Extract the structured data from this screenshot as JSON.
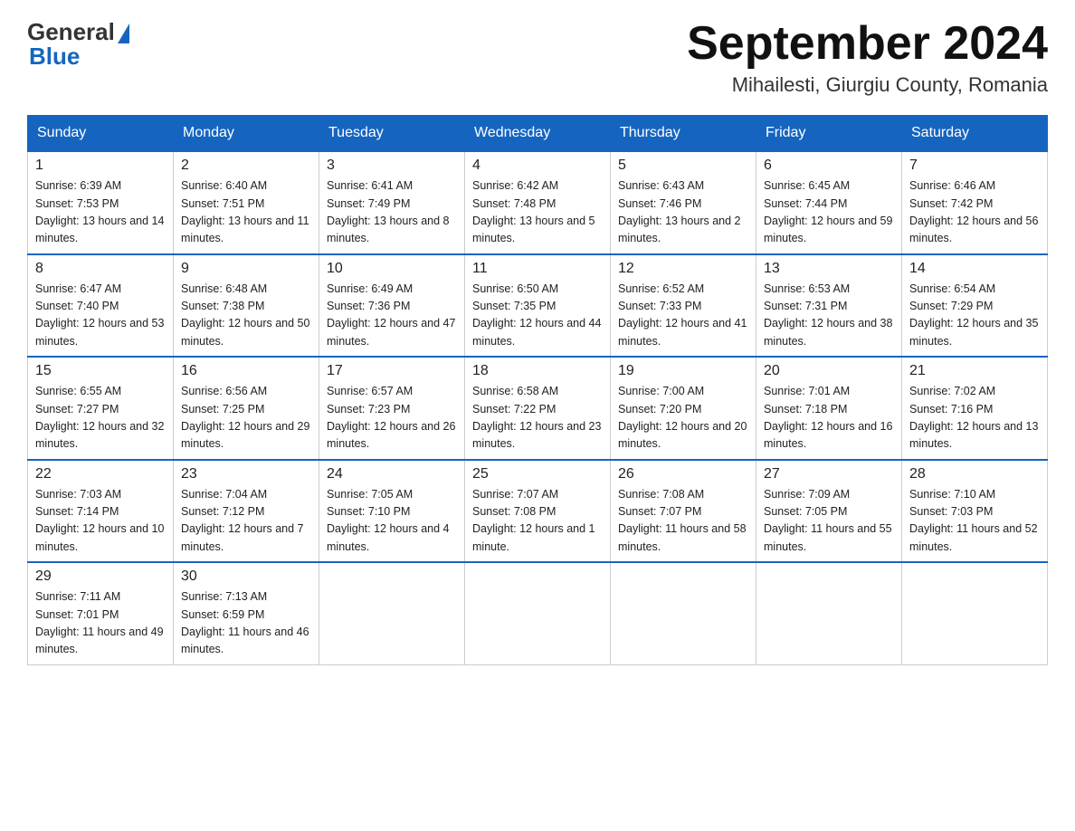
{
  "header": {
    "logo_general": "General",
    "logo_blue": "Blue",
    "month_title": "September 2024",
    "location": "Mihailesti, Giurgiu County, Romania"
  },
  "days_of_week": [
    "Sunday",
    "Monday",
    "Tuesday",
    "Wednesday",
    "Thursday",
    "Friday",
    "Saturday"
  ],
  "weeks": [
    [
      {
        "day": "1",
        "sunrise": "6:39 AM",
        "sunset": "7:53 PM",
        "daylight": "13 hours and 14 minutes."
      },
      {
        "day": "2",
        "sunrise": "6:40 AM",
        "sunset": "7:51 PM",
        "daylight": "13 hours and 11 minutes."
      },
      {
        "day": "3",
        "sunrise": "6:41 AM",
        "sunset": "7:49 PM",
        "daylight": "13 hours and 8 minutes."
      },
      {
        "day": "4",
        "sunrise": "6:42 AM",
        "sunset": "7:48 PM",
        "daylight": "13 hours and 5 minutes."
      },
      {
        "day": "5",
        "sunrise": "6:43 AM",
        "sunset": "7:46 PM",
        "daylight": "13 hours and 2 minutes."
      },
      {
        "day": "6",
        "sunrise": "6:45 AM",
        "sunset": "7:44 PM",
        "daylight": "12 hours and 59 minutes."
      },
      {
        "day": "7",
        "sunrise": "6:46 AM",
        "sunset": "7:42 PM",
        "daylight": "12 hours and 56 minutes."
      }
    ],
    [
      {
        "day": "8",
        "sunrise": "6:47 AM",
        "sunset": "7:40 PM",
        "daylight": "12 hours and 53 minutes."
      },
      {
        "day": "9",
        "sunrise": "6:48 AM",
        "sunset": "7:38 PM",
        "daylight": "12 hours and 50 minutes."
      },
      {
        "day": "10",
        "sunrise": "6:49 AM",
        "sunset": "7:36 PM",
        "daylight": "12 hours and 47 minutes."
      },
      {
        "day": "11",
        "sunrise": "6:50 AM",
        "sunset": "7:35 PM",
        "daylight": "12 hours and 44 minutes."
      },
      {
        "day": "12",
        "sunrise": "6:52 AM",
        "sunset": "7:33 PM",
        "daylight": "12 hours and 41 minutes."
      },
      {
        "day": "13",
        "sunrise": "6:53 AM",
        "sunset": "7:31 PM",
        "daylight": "12 hours and 38 minutes."
      },
      {
        "day": "14",
        "sunrise": "6:54 AM",
        "sunset": "7:29 PM",
        "daylight": "12 hours and 35 minutes."
      }
    ],
    [
      {
        "day": "15",
        "sunrise": "6:55 AM",
        "sunset": "7:27 PM",
        "daylight": "12 hours and 32 minutes."
      },
      {
        "day": "16",
        "sunrise": "6:56 AM",
        "sunset": "7:25 PM",
        "daylight": "12 hours and 29 minutes."
      },
      {
        "day": "17",
        "sunrise": "6:57 AM",
        "sunset": "7:23 PM",
        "daylight": "12 hours and 26 minutes."
      },
      {
        "day": "18",
        "sunrise": "6:58 AM",
        "sunset": "7:22 PM",
        "daylight": "12 hours and 23 minutes."
      },
      {
        "day": "19",
        "sunrise": "7:00 AM",
        "sunset": "7:20 PM",
        "daylight": "12 hours and 20 minutes."
      },
      {
        "day": "20",
        "sunrise": "7:01 AM",
        "sunset": "7:18 PM",
        "daylight": "12 hours and 16 minutes."
      },
      {
        "day": "21",
        "sunrise": "7:02 AM",
        "sunset": "7:16 PM",
        "daylight": "12 hours and 13 minutes."
      }
    ],
    [
      {
        "day": "22",
        "sunrise": "7:03 AM",
        "sunset": "7:14 PM",
        "daylight": "12 hours and 10 minutes."
      },
      {
        "day": "23",
        "sunrise": "7:04 AM",
        "sunset": "7:12 PM",
        "daylight": "12 hours and 7 minutes."
      },
      {
        "day": "24",
        "sunrise": "7:05 AM",
        "sunset": "7:10 PM",
        "daylight": "12 hours and 4 minutes."
      },
      {
        "day": "25",
        "sunrise": "7:07 AM",
        "sunset": "7:08 PM",
        "daylight": "12 hours and 1 minute."
      },
      {
        "day": "26",
        "sunrise": "7:08 AM",
        "sunset": "7:07 PM",
        "daylight": "11 hours and 58 minutes."
      },
      {
        "day": "27",
        "sunrise": "7:09 AM",
        "sunset": "7:05 PM",
        "daylight": "11 hours and 55 minutes."
      },
      {
        "day": "28",
        "sunrise": "7:10 AM",
        "sunset": "7:03 PM",
        "daylight": "11 hours and 52 minutes."
      }
    ],
    [
      {
        "day": "29",
        "sunrise": "7:11 AM",
        "sunset": "7:01 PM",
        "daylight": "11 hours and 49 minutes."
      },
      {
        "day": "30",
        "sunrise": "7:13 AM",
        "sunset": "6:59 PM",
        "daylight": "11 hours and 46 minutes."
      },
      null,
      null,
      null,
      null,
      null
    ]
  ]
}
